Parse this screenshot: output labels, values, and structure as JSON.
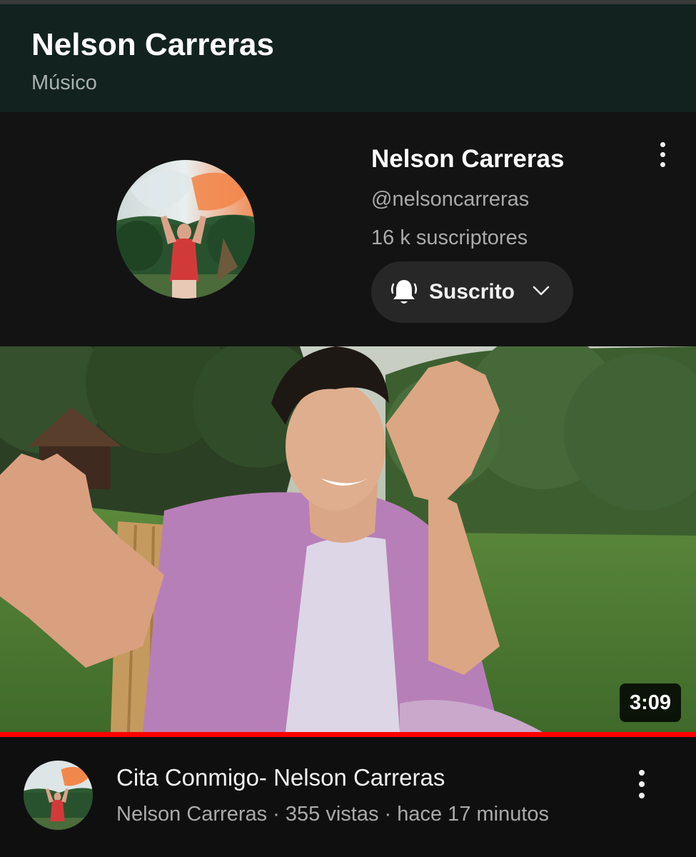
{
  "header": {
    "title": "Nelson Carreras",
    "subtitle": "Músico"
  },
  "channel": {
    "name": "Nelson Carreras",
    "handle": "@nelsoncarreras",
    "subscribers": "16 k suscriptores",
    "subscribe_button": {
      "label": "Suscrito",
      "icon": "bell-icon",
      "dropdown_icon": "chevron-down-icon"
    },
    "menu_icon": "more-vert-icon"
  },
  "video": {
    "duration": "3:09",
    "watched_fraction": 1.0,
    "title": "Cita Conmigo- Nelson Carreras",
    "meta": "Nelson Carreras · 355 vistas · hace 17 minutos",
    "menu_icon": "more-vert-icon"
  },
  "colors": {
    "header_bg": "#11221f",
    "page_bg": "#0f0f0f",
    "button_bg": "#272727",
    "progress": "#ff0000"
  }
}
